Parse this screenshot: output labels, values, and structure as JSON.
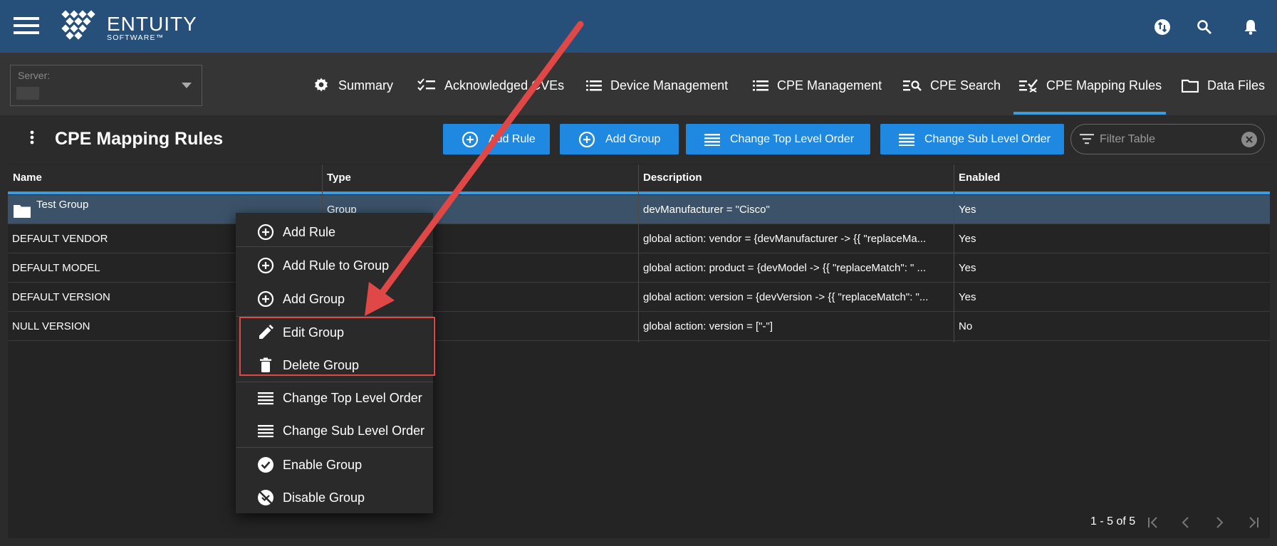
{
  "header": {
    "logo_name": "ENTUITY",
    "logo_sub": "SOFTWARE™",
    "icons": [
      "sync-icon",
      "search-icon",
      "bell-icon"
    ]
  },
  "server": {
    "label": "Server:",
    "value": ""
  },
  "tabs": [
    {
      "label": "Summary",
      "icon": "gear-icon"
    },
    {
      "label": "Acknowledged CVEs",
      "icon": "checklist-icon"
    },
    {
      "label": "Device Management",
      "icon": "list-icon"
    },
    {
      "label": "CPE Management",
      "icon": "list-icon"
    },
    {
      "label": "CPE Search",
      "icon": "list-search-icon"
    },
    {
      "label": "CPE Mapping Rules",
      "icon": "list-check-icon",
      "active": true
    },
    {
      "label": "Data Files",
      "icon": "folder-icon"
    }
  ],
  "page": {
    "title": "CPE Mapping Rules"
  },
  "toolbar": {
    "add_rule": "Add Rule",
    "add_group": "Add Group",
    "change_top": "Change Top Level Order",
    "change_sub": "Change Sub Level Order",
    "filter_placeholder": "Filter Table"
  },
  "table": {
    "columns": [
      "Name",
      "Type",
      "Description",
      "Enabled"
    ],
    "rows": [
      {
        "name": "Test Group",
        "type": "Group",
        "description": "devManufacturer = \"Cisco\"",
        "enabled": "Yes"
      },
      {
        "name": "DEFAULT VENDOR",
        "type": "",
        "description": "global action: vendor = {devManufacturer -> {{ \"replaceMa...",
        "enabled": "Yes"
      },
      {
        "name": "DEFAULT MODEL",
        "type": "",
        "description": "global action: product = {devModel -> {{ \"replaceMatch\": \" ...",
        "enabled": "Yes"
      },
      {
        "name": "DEFAULT VERSION",
        "type": "",
        "description": "global action: version = {devVersion -> {{ \"replaceMatch\": \"...",
        "enabled": "Yes"
      },
      {
        "name": "NULL VERSION",
        "type": "",
        "description": "global action: version = [\"-\"]",
        "enabled": "No"
      }
    ]
  },
  "context_menu": {
    "items": [
      {
        "label": "Add Rule",
        "icon": "plus-circle-icon"
      },
      {
        "label": "Add Rule to Group",
        "icon": "plus-circle-icon"
      },
      {
        "label": "Add Group",
        "icon": "plus-circle-icon"
      },
      {
        "label": "Edit Group",
        "icon": "pencil-icon"
      },
      {
        "label": "Delete Group",
        "icon": "trash-icon"
      },
      {
        "label": "Change Top Level Order",
        "icon": "lines-icon"
      },
      {
        "label": "Change Sub Level Order",
        "icon": "lines-icon"
      },
      {
        "label": "Enable Group",
        "icon": "check-circle-icon"
      },
      {
        "label": "Disable Group",
        "icon": "disable-icon"
      }
    ]
  },
  "pagination": {
    "range": "1 - 5 of 5"
  },
  "colors": {
    "header_bg": "#26507a",
    "accent": "#3d9be0",
    "button": "#1f88e0",
    "selected_row": "#3b5268",
    "annotation": "#e04848"
  }
}
